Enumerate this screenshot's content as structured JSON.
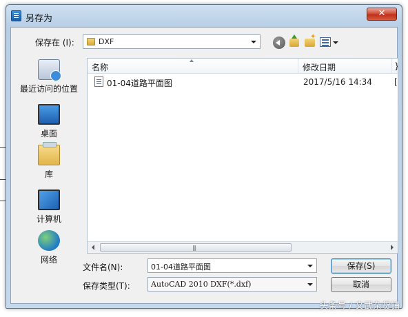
{
  "window": {
    "title": "另存为",
    "close_glyph": "✕"
  },
  "toolbar": {
    "save_in_label": "保存在 (I):",
    "location_value": "DXF"
  },
  "places": [
    {
      "label": "最近访问的位置",
      "icon": "recent-places-icon"
    },
    {
      "label": "桌面",
      "icon": "desktop-icon"
    },
    {
      "label": "库",
      "icon": "libraries-icon"
    },
    {
      "label": "计算机",
      "icon": "computer-icon"
    },
    {
      "label": "网络",
      "icon": "network-icon"
    }
  ],
  "filelist": {
    "columns": [
      "名称",
      "修改日期"
    ],
    "extra_column_glyph": "}",
    "rows": [
      {
        "name": "01-04道路平面图",
        "modified": "2017/5/16 14:34",
        "extra": "["
      }
    ],
    "scroll_grip": "|||"
  },
  "form": {
    "filename_label": "文件名(N):",
    "filename_value": "01-04道路平面图",
    "filetype_label": "保存类型(T):",
    "filetype_value": "AutoCAD 2010 DXF(*.dxf)"
  },
  "buttons": {
    "save": "保存(S)",
    "cancel": "取消"
  },
  "watermark": "头条号 / 文武杂货铺"
}
